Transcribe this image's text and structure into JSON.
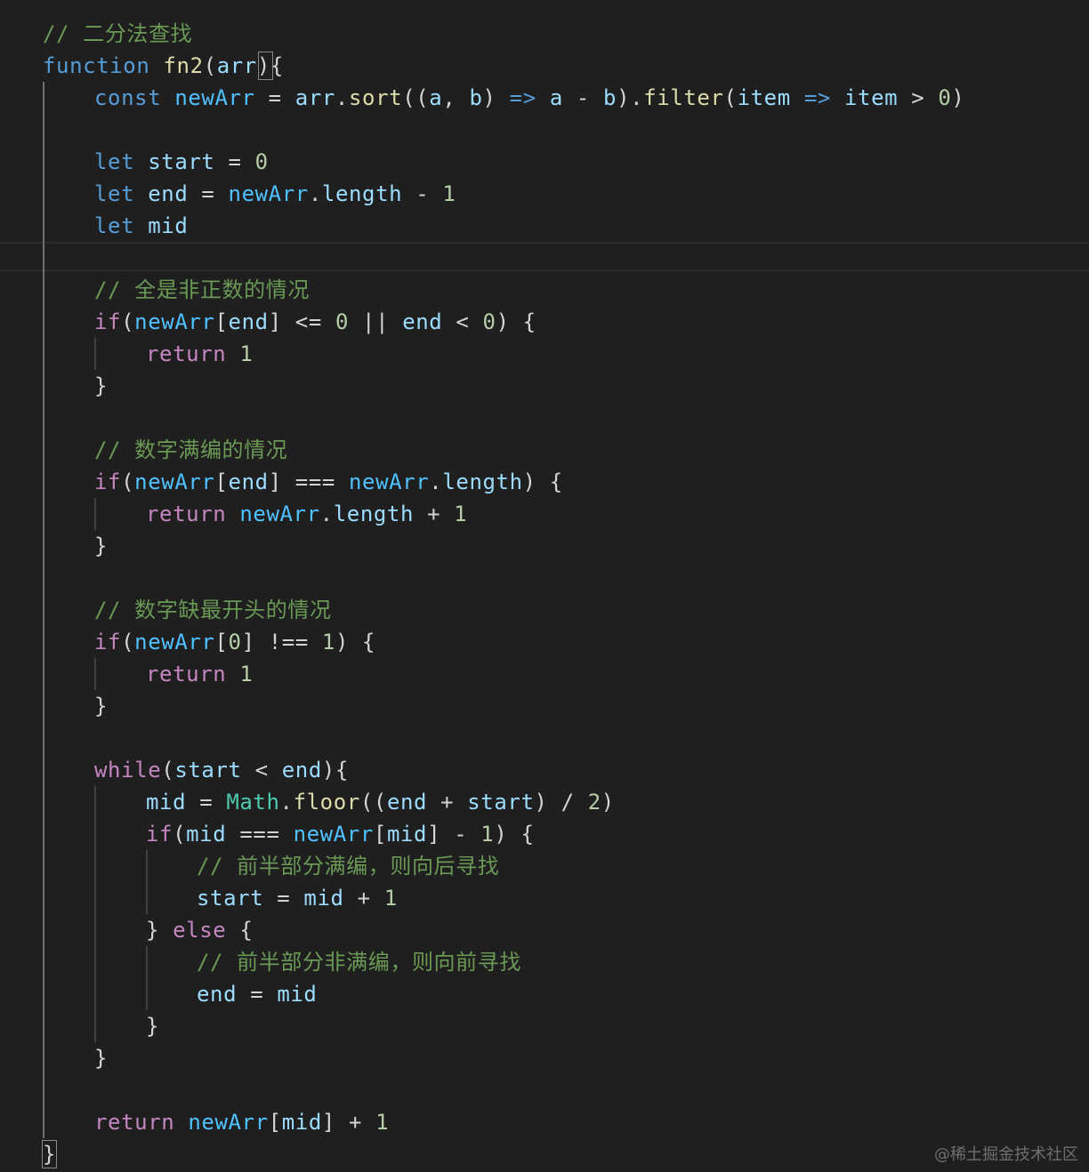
{
  "colors": {
    "background": "#1f1f1f",
    "comment": "#6a9955",
    "keyword": "#569cd6",
    "control": "#c586c0",
    "variable": "#9cdcfe",
    "function": "#dcdcaa",
    "number": "#b5cea8",
    "class": "#4ec9b0",
    "constant": "#4fc1ff",
    "text": "#d4d4d4"
  },
  "lines": [
    {
      "tokens": [
        {
          "text": "// 二分法查找",
          "kind": "comment"
        }
      ]
    },
    {
      "tokens": [
        {
          "text": "function",
          "kind": "keyword"
        },
        {
          "text": " ",
          "kind": "text"
        },
        {
          "text": "fn2",
          "kind": "function"
        },
        {
          "text": "(",
          "kind": "text"
        },
        {
          "text": "arr",
          "kind": "variable"
        },
        {
          "text": "){",
          "kind": "text"
        }
      ]
    },
    {
      "tokens": [
        {
          "text": "const",
          "kind": "keyword"
        },
        {
          "text": " ",
          "kind": "text"
        },
        {
          "text": "newArr",
          "kind": "constant"
        },
        {
          "text": " = ",
          "kind": "text"
        },
        {
          "text": "arr",
          "kind": "variable"
        },
        {
          "text": ".",
          "kind": "text"
        },
        {
          "text": "sort",
          "kind": "function"
        },
        {
          "text": "((",
          "kind": "text"
        },
        {
          "text": "a",
          "kind": "variable"
        },
        {
          "text": ", ",
          "kind": "text"
        },
        {
          "text": "b",
          "kind": "variable"
        },
        {
          "text": ") ",
          "kind": "text"
        },
        {
          "text": "=>",
          "kind": "keyword"
        },
        {
          "text": " ",
          "kind": "text"
        },
        {
          "text": "a",
          "kind": "variable"
        },
        {
          "text": " - ",
          "kind": "text"
        },
        {
          "text": "b",
          "kind": "variable"
        },
        {
          "text": ").",
          "kind": "text"
        },
        {
          "text": "filter",
          "kind": "function"
        },
        {
          "text": "(",
          "kind": "text"
        },
        {
          "text": "item",
          "kind": "variable"
        },
        {
          "text": " ",
          "kind": "text"
        },
        {
          "text": "=>",
          "kind": "keyword"
        },
        {
          "text": " ",
          "kind": "text"
        },
        {
          "text": "item",
          "kind": "variable"
        },
        {
          "text": " > ",
          "kind": "text"
        },
        {
          "text": "0",
          "kind": "number"
        },
        {
          "text": ")",
          "kind": "text"
        }
      ]
    },
    {
      "tokens": []
    },
    {
      "tokens": [
        {
          "text": "let",
          "kind": "keyword"
        },
        {
          "text": " ",
          "kind": "text"
        },
        {
          "text": "start",
          "kind": "variable"
        },
        {
          "text": " = ",
          "kind": "text"
        },
        {
          "text": "0",
          "kind": "number"
        }
      ]
    },
    {
      "tokens": [
        {
          "text": "let",
          "kind": "keyword"
        },
        {
          "text": " ",
          "kind": "text"
        },
        {
          "text": "end",
          "kind": "variable"
        },
        {
          "text": " = ",
          "kind": "text"
        },
        {
          "text": "newArr",
          "kind": "constant"
        },
        {
          "text": ".",
          "kind": "text"
        },
        {
          "text": "length",
          "kind": "variable"
        },
        {
          "text": " - ",
          "kind": "text"
        },
        {
          "text": "1",
          "kind": "number"
        }
      ]
    },
    {
      "tokens": [
        {
          "text": "let",
          "kind": "keyword"
        },
        {
          "text": " ",
          "kind": "text"
        },
        {
          "text": "mid",
          "kind": "variable"
        }
      ]
    },
    {
      "tokens": []
    },
    {
      "tokens": [
        {
          "text": "// 全是非正数的情况",
          "kind": "comment"
        }
      ]
    },
    {
      "tokens": [
        {
          "text": "if",
          "kind": "control"
        },
        {
          "text": "(",
          "kind": "text"
        },
        {
          "text": "newArr",
          "kind": "constant"
        },
        {
          "text": "[",
          "kind": "text"
        },
        {
          "text": "end",
          "kind": "variable"
        },
        {
          "text": "] <= ",
          "kind": "text"
        },
        {
          "text": "0",
          "kind": "number"
        },
        {
          "text": " || ",
          "kind": "text"
        },
        {
          "text": "end",
          "kind": "variable"
        },
        {
          "text": " < ",
          "kind": "text"
        },
        {
          "text": "0",
          "kind": "number"
        },
        {
          "text": ") {",
          "kind": "text"
        }
      ]
    },
    {
      "tokens": [
        {
          "text": "return",
          "kind": "control"
        },
        {
          "text": " ",
          "kind": "text"
        },
        {
          "text": "1",
          "kind": "number"
        }
      ]
    },
    {
      "tokens": [
        {
          "text": "}",
          "kind": "text"
        }
      ]
    },
    {
      "tokens": []
    },
    {
      "tokens": [
        {
          "text": "// 数字满编的情况",
          "kind": "comment"
        }
      ]
    },
    {
      "tokens": [
        {
          "text": "if",
          "kind": "control"
        },
        {
          "text": "(",
          "kind": "text"
        },
        {
          "text": "newArr",
          "kind": "constant"
        },
        {
          "text": "[",
          "kind": "text"
        },
        {
          "text": "end",
          "kind": "variable"
        },
        {
          "text": "] === ",
          "kind": "text"
        },
        {
          "text": "newArr",
          "kind": "constant"
        },
        {
          "text": ".",
          "kind": "text"
        },
        {
          "text": "length",
          "kind": "variable"
        },
        {
          "text": ") {",
          "kind": "text"
        }
      ]
    },
    {
      "tokens": [
        {
          "text": "return",
          "kind": "control"
        },
        {
          "text": " ",
          "kind": "text"
        },
        {
          "text": "newArr",
          "kind": "constant"
        },
        {
          "text": ".",
          "kind": "text"
        },
        {
          "text": "length",
          "kind": "variable"
        },
        {
          "text": " + ",
          "kind": "text"
        },
        {
          "text": "1",
          "kind": "number"
        }
      ]
    },
    {
      "tokens": [
        {
          "text": "}",
          "kind": "text"
        }
      ]
    },
    {
      "tokens": []
    },
    {
      "tokens": [
        {
          "text": "// 数字缺最开头的情况",
          "kind": "comment"
        }
      ]
    },
    {
      "tokens": [
        {
          "text": "if",
          "kind": "control"
        },
        {
          "text": "(",
          "kind": "text"
        },
        {
          "text": "newArr",
          "kind": "constant"
        },
        {
          "text": "[",
          "kind": "text"
        },
        {
          "text": "0",
          "kind": "number"
        },
        {
          "text": "] !== ",
          "kind": "text"
        },
        {
          "text": "1",
          "kind": "number"
        },
        {
          "text": ") {",
          "kind": "text"
        }
      ]
    },
    {
      "tokens": [
        {
          "text": "return",
          "kind": "control"
        },
        {
          "text": " ",
          "kind": "text"
        },
        {
          "text": "1",
          "kind": "number"
        }
      ]
    },
    {
      "tokens": [
        {
          "text": "}",
          "kind": "text"
        }
      ]
    },
    {
      "tokens": []
    },
    {
      "tokens": [
        {
          "text": "while",
          "kind": "control"
        },
        {
          "text": "(",
          "kind": "text"
        },
        {
          "text": "start",
          "kind": "variable"
        },
        {
          "text": " < ",
          "kind": "text"
        },
        {
          "text": "end",
          "kind": "variable"
        },
        {
          "text": "){",
          "kind": "text"
        }
      ]
    },
    {
      "tokens": [
        {
          "text": "mid",
          "kind": "variable"
        },
        {
          "text": " = ",
          "kind": "text"
        },
        {
          "text": "Math",
          "kind": "class"
        },
        {
          "text": ".",
          "kind": "text"
        },
        {
          "text": "floor",
          "kind": "function"
        },
        {
          "text": "((",
          "kind": "text"
        },
        {
          "text": "end",
          "kind": "variable"
        },
        {
          "text": " + ",
          "kind": "text"
        },
        {
          "text": "start",
          "kind": "variable"
        },
        {
          "text": ") / ",
          "kind": "text"
        },
        {
          "text": "2",
          "kind": "number"
        },
        {
          "text": ")",
          "kind": "text"
        }
      ]
    },
    {
      "tokens": [
        {
          "text": "if",
          "kind": "control"
        },
        {
          "text": "(",
          "kind": "text"
        },
        {
          "text": "mid",
          "kind": "variable"
        },
        {
          "text": " === ",
          "kind": "text"
        },
        {
          "text": "newArr",
          "kind": "constant"
        },
        {
          "text": "[",
          "kind": "text"
        },
        {
          "text": "mid",
          "kind": "variable"
        },
        {
          "text": "] - ",
          "kind": "text"
        },
        {
          "text": "1",
          "kind": "number"
        },
        {
          "text": ") {",
          "kind": "text"
        }
      ]
    },
    {
      "tokens": [
        {
          "text": "// 前半部分满编，则向后寻找",
          "kind": "comment"
        }
      ]
    },
    {
      "tokens": [
        {
          "text": "start",
          "kind": "variable"
        },
        {
          "text": " = ",
          "kind": "text"
        },
        {
          "text": "mid",
          "kind": "variable"
        },
        {
          "text": " + ",
          "kind": "text"
        },
        {
          "text": "1",
          "kind": "number"
        }
      ]
    },
    {
      "tokens": [
        {
          "text": "} ",
          "kind": "text"
        },
        {
          "text": "else",
          "kind": "control"
        },
        {
          "text": " {",
          "kind": "text"
        }
      ]
    },
    {
      "tokens": [
        {
          "text": "// 前半部分非满编，则向前寻找",
          "kind": "comment"
        }
      ]
    },
    {
      "tokens": [
        {
          "text": "end",
          "kind": "variable"
        },
        {
          "text": " = ",
          "kind": "text"
        },
        {
          "text": "mid",
          "kind": "variable"
        }
      ]
    },
    {
      "tokens": [
        {
          "text": "}",
          "kind": "text"
        }
      ]
    },
    {
      "tokens": [
        {
          "text": "}",
          "kind": "text"
        }
      ]
    },
    {
      "tokens": []
    },
    {
      "tokens": [
        {
          "text": "return",
          "kind": "control"
        },
        {
          "text": " ",
          "kind": "text"
        },
        {
          "text": "newArr",
          "kind": "constant"
        },
        {
          "text": "[",
          "kind": "text"
        },
        {
          "text": "mid",
          "kind": "variable"
        },
        {
          "text": "] + ",
          "kind": "text"
        },
        {
          "text": "1",
          "kind": "number"
        }
      ]
    },
    {
      "tokens": [
        {
          "text": "}",
          "kind": "text"
        }
      ]
    }
  ],
  "watermark": "@稀土掘金技术社区"
}
